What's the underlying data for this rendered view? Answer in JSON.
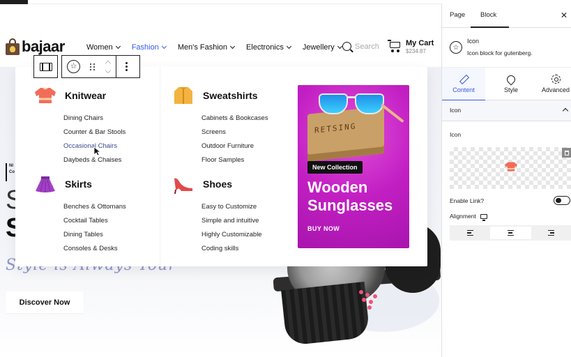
{
  "site": {
    "logo_text": "bajaar",
    "nav": [
      {
        "label": "Women",
        "active": false
      },
      {
        "label": "Fashion",
        "active": true
      },
      {
        "label": "Men's Fashion",
        "active": false
      },
      {
        "label": "Electronics",
        "active": false
      },
      {
        "label": "Jewellery",
        "active": false
      }
    ],
    "search_placeholder": "Search",
    "cart": {
      "title": "My Cart",
      "price": "$234.87"
    },
    "accent_color": "#3858e9"
  },
  "mega_menu": {
    "columns": [
      {
        "title": "Knitwear",
        "icon": "sweater-icon",
        "items": [
          "Dining Chairs",
          "Counter & Bar Stools",
          "Occasional Chairs",
          "Daybeds & Chaises"
        ]
      },
      {
        "title": "Sweatshirts",
        "icon": "jacket-icon",
        "items": [
          "Cabinets & Bookcases",
          "Screens",
          "Outdoor Furniture",
          "Floor Samples"
        ]
      },
      {
        "title": "Skirts",
        "icon": "skirt-icon",
        "items": [
          "Benches & Ottomans",
          "Cocktail Tables",
          "Dining Tables",
          "Consoles & Desks"
        ]
      },
      {
        "title": "Shoes",
        "icon": "heel-shoe-icon",
        "items": [
          "Easy to Customize",
          "Simple and intuitive",
          "Highly Customizable",
          "Coding skills"
        ]
      }
    ],
    "promo": {
      "box_text": "RETSING",
      "badge": "New Collection",
      "headline_1": "Wooden",
      "headline_2": "Sunglasses",
      "cta": "BUY NOW",
      "bg_color": "#c21fc3"
    }
  },
  "hero": {
    "tag_1": "NI",
    "tag_2": "Co",
    "line_1": "S",
    "line_2": "S",
    "script_text": "Style is Always Your",
    "cta": "Discover Now"
  },
  "sidebar": {
    "tabs": [
      {
        "label": "Page"
      },
      {
        "label": "Block"
      }
    ],
    "close_glyph": "✕",
    "block": {
      "name": "Icon",
      "description": "Icon block for gutenberg."
    },
    "subtabs": [
      {
        "label": "Content"
      },
      {
        "label": "Style"
      },
      {
        "label": "Advanced"
      }
    ],
    "panel_title": "Icon",
    "icon_label": "Icon",
    "enable_link_label": "Enable Link?",
    "enable_link_on": false,
    "alignment_label": "Alignment",
    "alignment_selected": "center"
  }
}
